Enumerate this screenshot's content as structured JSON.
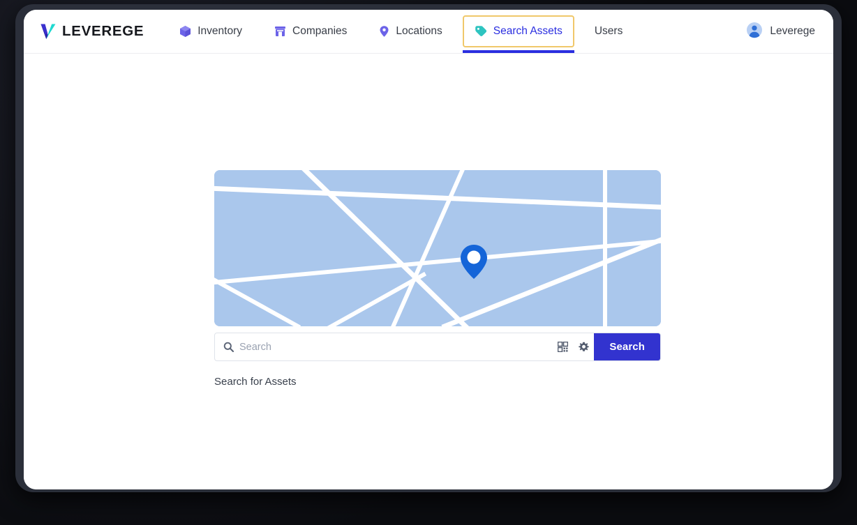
{
  "brand": {
    "name": "LEVEREGE",
    "logo_icon": "leverege-v-logo",
    "logo_colors": {
      "left": "#2b1fa8",
      "right": "#1fd9d0"
    }
  },
  "navbar": {
    "items": [
      {
        "label": "Inventory",
        "icon": "cube-icon",
        "active": false,
        "icon_color": "#6c63e8"
      },
      {
        "label": "Companies",
        "icon": "building-icon",
        "active": false,
        "icon_color": "#6c63e8"
      },
      {
        "label": "Locations",
        "icon": "map-pin-icon",
        "active": false,
        "icon_color": "#6c63e8"
      },
      {
        "label": "Search Assets",
        "icon": "tag-icon",
        "active": true,
        "icon_color": "#2ec4c0"
      },
      {
        "label": "Users",
        "icon": "none",
        "active": false,
        "icon_color": "#6c63e8"
      }
    ],
    "active_tab": "Search Assets",
    "focus_ring_color": "#f0c86a",
    "active_underline_color": "#2a2ee0",
    "active_text_color": "#2a2ee0",
    "user": {
      "name": "Leverege",
      "icon": "avatar-icon"
    }
  },
  "main": {
    "map": {
      "icon": "map-placeholder",
      "pin_icon": "map-pin-marker",
      "background_color": "#aac7ec",
      "road_color": "#ffffff",
      "pin_color": "#1565d8"
    },
    "search": {
      "value": "",
      "placeholder": "Search",
      "search_icon": "magnifier-icon",
      "qr_icon": "qr-scan-icon",
      "settings_icon": "gear-icon",
      "button_label": "Search",
      "button_color": "#3233cf"
    },
    "results_hint": "Search for Assets"
  }
}
